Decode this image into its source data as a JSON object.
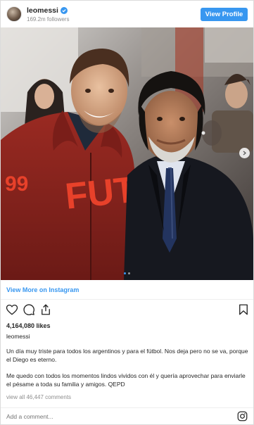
{
  "header": {
    "username": "leomessi",
    "followers": "169.2m followers",
    "view_profile_label": "View Profile"
  },
  "post": {
    "view_more_label": "View More on Instagram",
    "likes": "4,164,080 likes",
    "caption_user": "leomessi",
    "caption_paragraphs": [
      "Un día muy triste para todos los argentinos y para el fútbol. Nos deja pero no se va, porque el Diego es eterno.",
      "Me quedo con todos los momentos lindos vividos con él y quería aprovechar para enviarle el pésame a toda su familia y amigos. QEPD"
    ],
    "comments_link": "view all 46,447 comments",
    "comment_placeholder": "Add a comment...",
    "jersey_text": "FUT",
    "jersey_number": "99",
    "carousel": {
      "slides": 2,
      "active": 1
    }
  },
  "colors": {
    "accent": "#3897f0",
    "text": "#262626",
    "muted": "#8e8e8e",
    "border": "#dbdbdb"
  },
  "icons": {
    "verified": "verified-badge-icon",
    "heart": "heart-icon",
    "comment": "comment-icon",
    "share": "share-icon",
    "bookmark": "bookmark-icon",
    "instagram": "instagram-logo-icon",
    "next": "chevron-right-icon"
  }
}
